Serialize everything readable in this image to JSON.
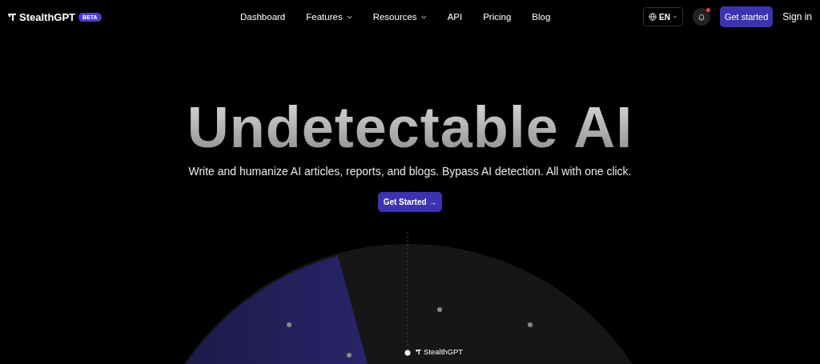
{
  "brand": {
    "name": "StealthGPT",
    "badge": "BETA"
  },
  "nav": [
    {
      "label": "Dashboard",
      "has_menu": false
    },
    {
      "label": "Features",
      "has_menu": true
    },
    {
      "label": "Resources",
      "has_menu": true
    },
    {
      "label": "API",
      "has_menu": false
    },
    {
      "label": "Pricing",
      "has_menu": false
    },
    {
      "label": "Blog",
      "has_menu": false
    }
  ],
  "language": {
    "label": "EN"
  },
  "notifications": {
    "unread": true
  },
  "actions": {
    "primary": "Get started",
    "secondary": "Sign in"
  },
  "hero": {
    "title": "Undetectable AI",
    "subtitle": "Write and humanize AI articles, reports, and blogs. Bypass AI detection. All with one click.",
    "button": "Get Started →"
  },
  "radar": {
    "label": "StealthGPT"
  }
}
